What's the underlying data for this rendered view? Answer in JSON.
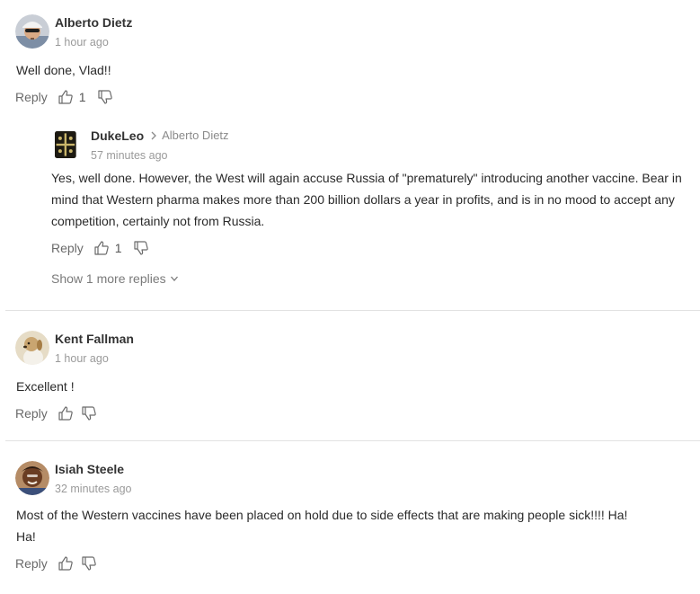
{
  "comments": [
    {
      "author": "Alberto Dietz",
      "time": "1 hour ago",
      "text": "Well done, Vlad!!",
      "reply_label": "Reply",
      "likes": "1",
      "replies": [
        {
          "author": "DukeLeo",
          "reply_to": "Alberto Dietz",
          "time": "57 minutes ago",
          "text": "Yes, well done.  However, the West will again accuse Russia of \"prematurely\" introducing another vaccine. Bear in mind that Western pharma makes more than 200 billion dollars a year in profits, and is in no mood to accept any competition, certainly not from Russia.",
          "reply_label": "Reply",
          "likes": "1"
        }
      ],
      "show_more": "Show 1 more replies"
    },
    {
      "author": "Kent Fallman",
      "time": "1 hour ago",
      "text": "Excellent !",
      "reply_label": "Reply",
      "likes": ""
    },
    {
      "author": "Isiah Steele",
      "time": "32 minutes ago",
      "text": "Most of the Western vaccines have been placed on hold due to side effects that are making people sick!!!! Ha! Ha!",
      "reply_label": "Reply",
      "likes": ""
    }
  ],
  "colors": {
    "text": "#2a2a2a",
    "muted": "#9a9a9a",
    "divider": "#e2e2e2",
    "icon": "#6a6a6a"
  }
}
